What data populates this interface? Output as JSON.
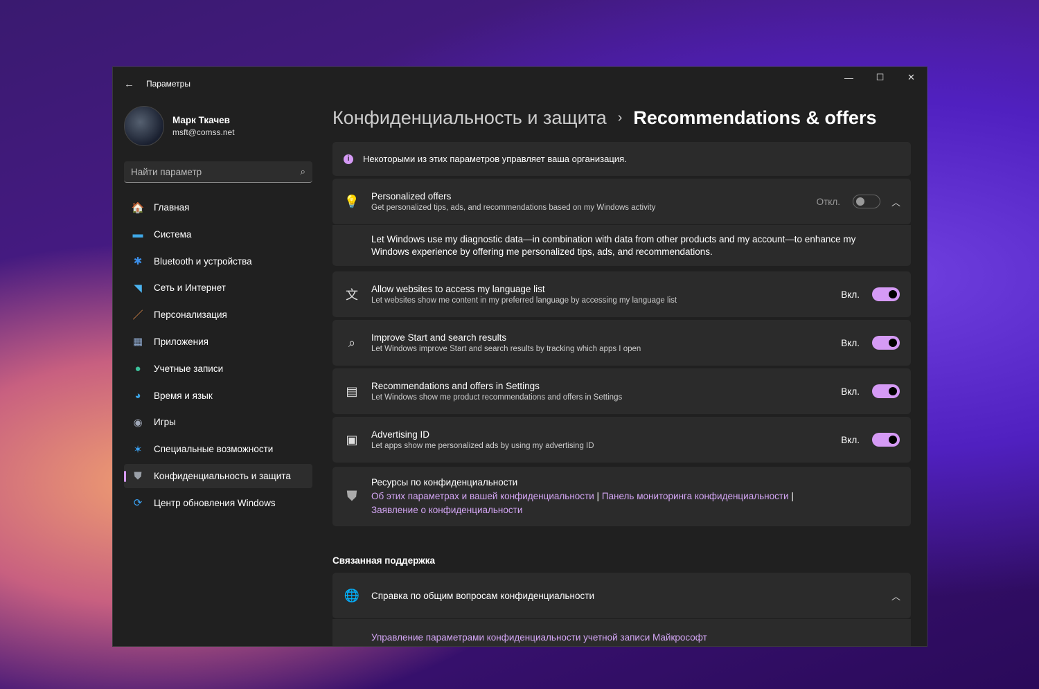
{
  "window": {
    "title": "Параметры",
    "minimize": "—",
    "maximize": "☐",
    "close": "✕"
  },
  "user": {
    "name": "Марк Ткачев",
    "email": "msft@comss.net"
  },
  "search": {
    "placeholder": "Найти параметр"
  },
  "nav": [
    {
      "label": "Главная",
      "icon": "home-icon",
      "glyph": "🏠",
      "color": "#f0a060"
    },
    {
      "label": "Система",
      "icon": "system-icon",
      "glyph": "▬",
      "color": "#3fa9e8"
    },
    {
      "label": "Bluetooth и устройства",
      "icon": "bluetooth-icon",
      "glyph": "✱",
      "color": "#3b8ee8"
    },
    {
      "label": "Сеть и Интернет",
      "icon": "wifi-icon",
      "glyph": "◥",
      "color": "#4cb4f0"
    },
    {
      "label": "Персонализация",
      "icon": "brush-icon",
      "glyph": "／",
      "color": "#e8904a"
    },
    {
      "label": "Приложения",
      "icon": "apps-icon",
      "glyph": "▦",
      "color": "#8aa4c8"
    },
    {
      "label": "Учетные записи",
      "icon": "accounts-icon",
      "glyph": "●",
      "color": "#3cc09a"
    },
    {
      "label": "Время и язык",
      "icon": "globe-clock-icon",
      "glyph": "◕",
      "color": "#3aa0e0"
    },
    {
      "label": "Игры",
      "icon": "gamepad-icon",
      "glyph": "◉",
      "color": "#a0a8b8"
    },
    {
      "label": "Специальные возможности",
      "icon": "accessibility-icon",
      "glyph": "✶",
      "color": "#3aa0f0"
    },
    {
      "label": "Конфиденциальность и защита",
      "icon": "shield-icon",
      "glyph": "⛊",
      "color": "#9aa0a8",
      "active": true
    },
    {
      "label": "Центр обновления Windows",
      "icon": "update-icon",
      "glyph": "⟳",
      "color": "#3aa0f0"
    }
  ],
  "breadcrumb": {
    "parent": "Конфиденциальность и защита",
    "separator": "›",
    "current": "Recommendations & offers"
  },
  "info": "Некоторыми из этих параметров управляет ваша организация.",
  "accent": "#d59af5",
  "settings": [
    {
      "title": "Personalized offers",
      "desc": "Get personalized tips, ads, and recommendations based on my Windows activity",
      "state": "Откл.",
      "on": false,
      "icon": "lightbulb-icon",
      "glyph": "💡",
      "expanded_text": "Let Windows use my diagnostic data—in combination with data from other products and my account—to enhance my Windows experience by offering me personalized tips, ads, and recommendations."
    },
    {
      "title": "Allow websites to access my language list",
      "desc": "Let websites show me content in my preferred language by accessing my language list",
      "state": "Вкл.",
      "on": true,
      "icon": "language-icon",
      "glyph": "文"
    },
    {
      "title": "Improve Start and search results",
      "desc": "Let Windows improve Start and search results by tracking which apps I open",
      "state": "Вкл.",
      "on": true,
      "icon": "search-icon",
      "glyph": "⌕"
    },
    {
      "title": "Recommendations and offers in Settings",
      "desc": "Let Windows show me product recommendations and offers in Settings",
      "state": "Вкл.",
      "on": true,
      "icon": "settings-offers-icon",
      "glyph": "▤"
    },
    {
      "title": "Advertising ID",
      "desc": "Let apps show me personalized ads by using my advertising ID",
      "state": "Вкл.",
      "on": true,
      "icon": "badge-icon",
      "glyph": "▣"
    }
  ],
  "resources": {
    "title": "Ресурсы по конфиденциальности",
    "links": [
      "Об этих параметрах и вашей конфиденциальности",
      "Панель мониторинга конфиденциальности",
      "Заявление о конфиденциальности"
    ],
    "sep": "|"
  },
  "related": {
    "heading": "Связанная поддержка",
    "item": "Справка по общим вопросам конфиденциальности",
    "link": "Управление параметрами конфиденциальности учетной записи Майкрософт"
  }
}
